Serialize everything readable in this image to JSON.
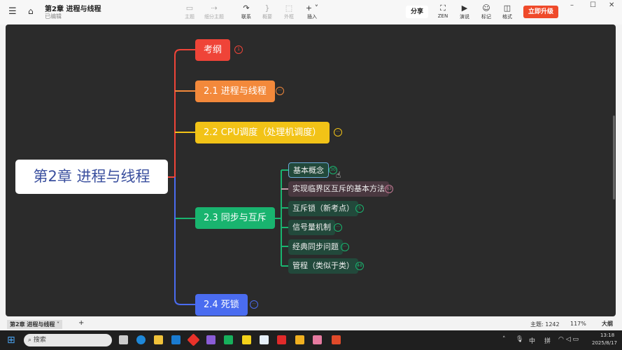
{
  "header": {
    "title": "第2章 进程与线程",
    "subtitle": "已编辑",
    "tools": [
      {
        "label": "主题",
        "icon": "topic-icon"
      },
      {
        "label": "细分主题",
        "icon": "subtopic-icon"
      },
      {
        "label": "联系",
        "icon": "relation-icon"
      },
      {
        "label": "概要",
        "icon": "summary-icon"
      },
      {
        "label": "外框",
        "icon": "boundary-icon"
      },
      {
        "label": "插入",
        "icon": "plus-icon"
      }
    ],
    "share": "分享",
    "right_tools": [
      {
        "label": "ZEN",
        "icon": "fullscreen-icon"
      },
      {
        "label": "演说",
        "icon": "play-icon"
      },
      {
        "label": "标记",
        "icon": "smiley-icon"
      },
      {
        "label": "格式",
        "icon": "panel-icon"
      }
    ],
    "upgrade": "立即升级"
  },
  "map": {
    "central": "第2章 进程与线程",
    "branches": [
      {
        "label": "考纲",
        "color": "#ef4438",
        "badge": "1"
      },
      {
        "label": "2.1 进程与线程",
        "color": "#f3893b",
        "badge": "···"
      },
      {
        "label": "2.2 CPU调度（处理机调度）",
        "color": "#f2c317",
        "badge": "···"
      },
      {
        "label": "2.3 同步与互斥",
        "color": "#19b46f",
        "badge": ""
      },
      {
        "label": "2.4 死锁",
        "color": "#4a6cf0",
        "badge": "···"
      }
    ],
    "subtopics": [
      {
        "label": "基本概念",
        "badge": "30"
      },
      {
        "label": "实现临界区互斥的基本方法",
        "badge": "63"
      },
      {
        "label": "互斥锁（新考点）",
        "badge": "5"
      },
      {
        "label": "信号量机制",
        "badge": "···"
      },
      {
        "label": "经典同步问题",
        "badge": "···"
      },
      {
        "label": "管程（类似于类）",
        "badge": "48"
      }
    ]
  },
  "status": {
    "sheet": "第2章 进程与线程",
    "add": "+",
    "topics": "主题: 1242",
    "zoom": "117%",
    "outline": "大纲"
  },
  "taskbar": {
    "search": "搜索",
    "ime1": "中",
    "ime2": "拼",
    "time": "13:18",
    "date": "2025/8/17"
  }
}
